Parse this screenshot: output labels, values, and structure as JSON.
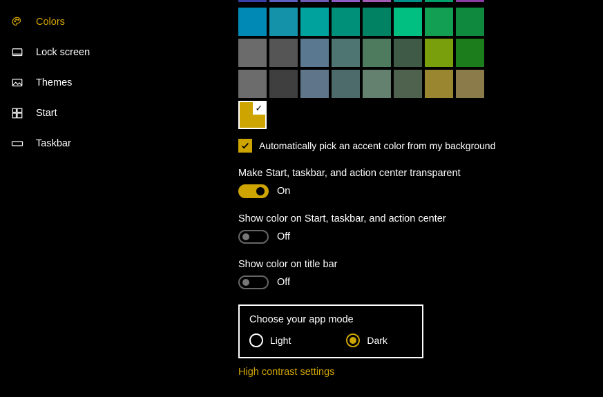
{
  "sidebar": {
    "items": [
      {
        "label": "Colors"
      },
      {
        "label": "Lock screen"
      },
      {
        "label": "Themes"
      },
      {
        "label": "Start"
      },
      {
        "label": "Taskbar"
      }
    ]
  },
  "swatches": {
    "row0": [
      "#3a3fa3",
      "#5f5fbf",
      "#6f5bb2",
      "#8e5bc3",
      "#a25ab3",
      "#00908a",
      "#009f6b",
      "#8b3ca3"
    ],
    "row1": [
      "#0089b5",
      "#1392a9",
      "#00a29e",
      "#008f79",
      "#008263",
      "#00bf80",
      "#129f53",
      "#0f893e"
    ],
    "row2": [
      "#6b6b6b",
      "#555555",
      "#5b7891",
      "#4f7572",
      "#4e7a5d",
      "#3f5b47",
      "#7a9f0d",
      "#1b7d1b"
    ],
    "row3": [
      "#6c6c6c",
      "#3f3f3f",
      "#5f768a",
      "#4e6b6b",
      "#64806e",
      "#4f624e",
      "#9a8530",
      "#8b7a4a"
    ]
  },
  "accent": {
    "color": "#cda400"
  },
  "auto_pick_label": "Automatically pick an accent color from my background",
  "transparent": {
    "label": "Make Start, taskbar, and action center transparent",
    "state_text": "On",
    "on": true
  },
  "show_color_start": {
    "label": "Show color on Start, taskbar, and action center",
    "state_text": "Off",
    "on": false
  },
  "show_color_title": {
    "label": "Show color on title bar",
    "state_text": "Off",
    "on": false
  },
  "app_mode": {
    "title": "Choose your app mode",
    "light_label": "Light",
    "dark_label": "Dark",
    "selected": "dark"
  },
  "high_contrast_link": "High contrast settings"
}
